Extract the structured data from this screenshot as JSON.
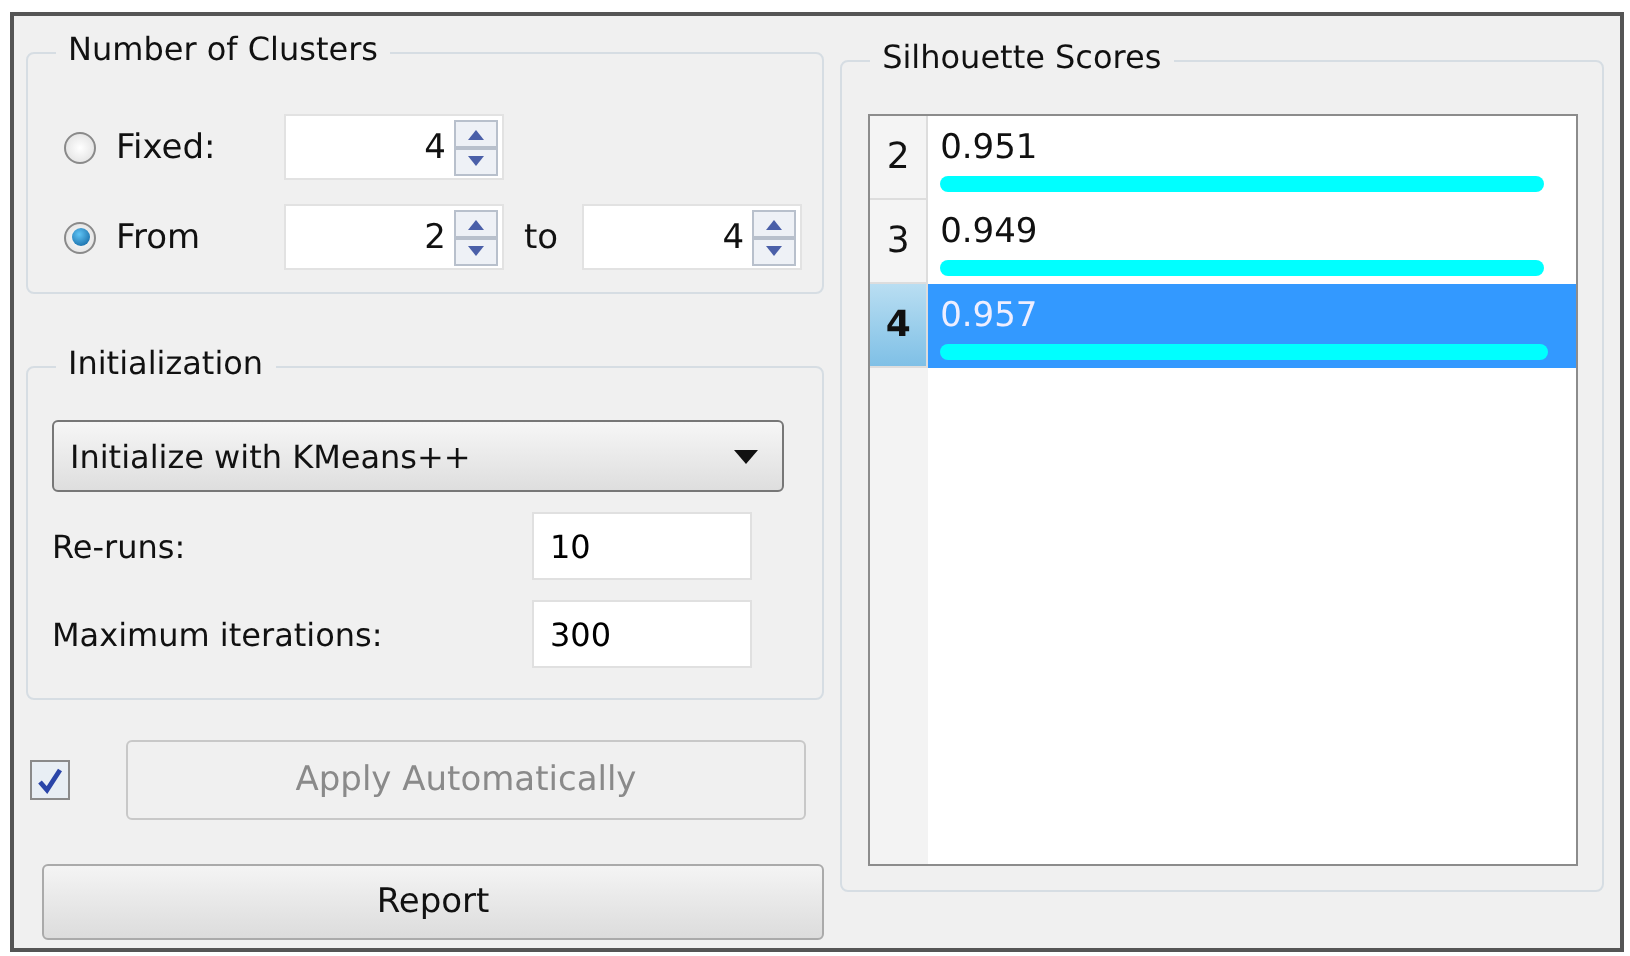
{
  "clusters": {
    "title": "Number of Clusters",
    "options": [
      {
        "label": "Fixed:",
        "selected": false,
        "value": "4"
      },
      {
        "label": "From",
        "selected": true,
        "value": "2",
        "to_label": "to",
        "to_value": "4"
      }
    ]
  },
  "initialization": {
    "title": "Initialization",
    "method": "Initialize with KMeans++",
    "fields": [
      {
        "label": "Re-runs:",
        "value": "10"
      },
      {
        "label": "Maximum iterations:",
        "value": "300"
      }
    ]
  },
  "auto_apply": {
    "checked": true,
    "label": "Apply Automatically",
    "disabled": true
  },
  "report_button": "Report",
  "scores": {
    "title": "Silhouette Scores",
    "rows": [
      {
        "k": "2",
        "score": "0.951",
        "level": 0.951,
        "selected": false
      },
      {
        "k": "3",
        "score": "0.949",
        "level": 0.949,
        "selected": false
      },
      {
        "k": "4",
        "score": "0.957",
        "level": 0.957,
        "selected": true
      }
    ]
  }
}
